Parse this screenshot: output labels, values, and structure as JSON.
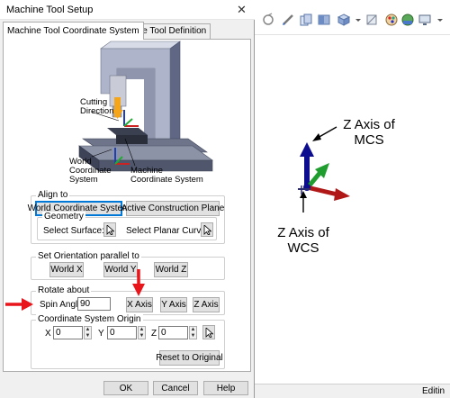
{
  "dialog": {
    "title": "Machine Tool Setup",
    "tabs": [
      "Machine Tool Coordinate System",
      "Machine Tool Definition"
    ],
    "illustration": {
      "cutting_direction": [
        "Cutting",
        "Direction"
      ],
      "wcs": [
        "World",
        "Coordinate",
        "System"
      ],
      "mcs": [
        "Machine",
        "Coordinate System"
      ]
    },
    "align_to": {
      "label": "Align to",
      "world_cs_button": "World Coordinate System",
      "active_plane_button": "Active Construction Plane",
      "geometry": {
        "label": "Geometry",
        "select_surface": "Select Surface:",
        "select_planar_curve": "Select Planar Curve:"
      }
    },
    "orientation": {
      "label": "Set Orientation parallel to",
      "buttons": [
        "World X",
        "World Y",
        "World Z"
      ]
    },
    "rotate": {
      "label": "Rotate about",
      "spin_label": "Spin Angle:",
      "spin_value": "90",
      "buttons": [
        "X Axis",
        "Y Axis",
        "Z Axis"
      ]
    },
    "origin": {
      "label": "Coordinate System Origin",
      "x_label": "X",
      "x_value": "0",
      "y_label": "Y",
      "y_value": "0",
      "z_label": "Z",
      "z_value": "0",
      "reset_button": "Reset to Original"
    },
    "footer": {
      "ok": "OK",
      "cancel": "Cancel",
      "help": "Help"
    }
  },
  "viewport": {
    "mcs_label": [
      "Z Axis of",
      "MCS"
    ],
    "wcs_label": [
      "Z Axis of",
      "WCS"
    ],
    "status": "Editin",
    "axis_colors": {
      "x": "#b01818",
      "y": "#1f9e2f",
      "z": "#0d0d8f"
    }
  },
  "toolbar_icons": [
    "view-rotate-icon",
    "pencil-icon",
    "copy-icon",
    "shade-icon",
    "view-cube-icon",
    "hide-show-icon",
    "color-palette-icon",
    "render-icon",
    "display-icon"
  ],
  "accent_color": "#e8151b"
}
